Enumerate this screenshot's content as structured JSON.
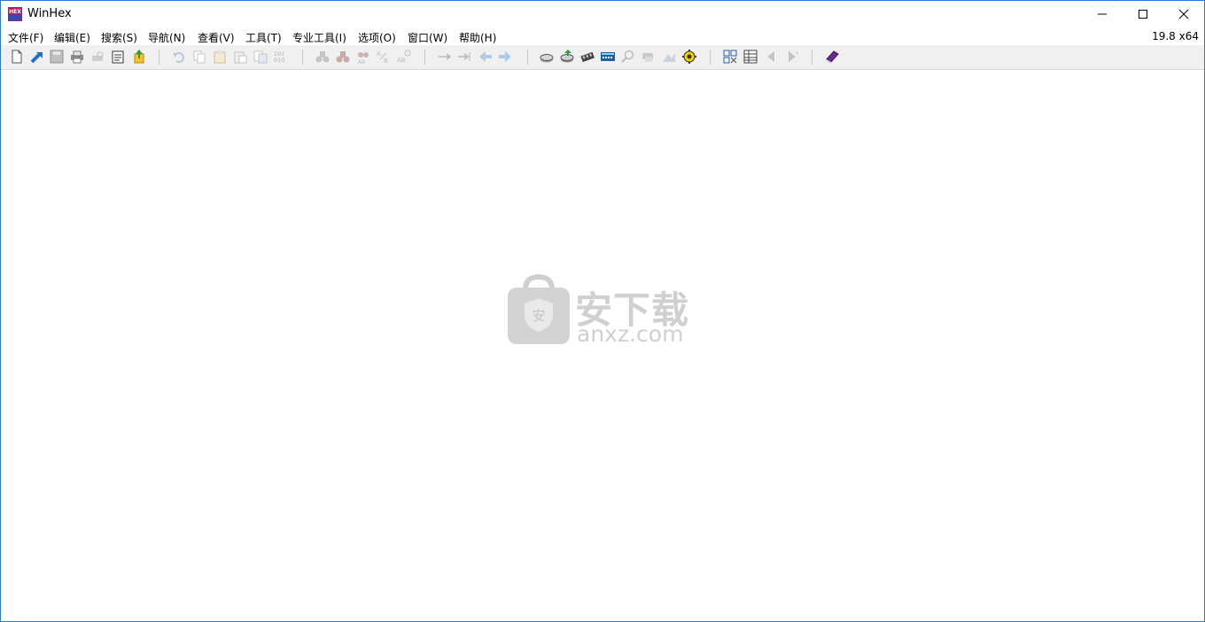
{
  "window": {
    "title": "WinHex",
    "version": "19.8 x64"
  },
  "menu": [
    "文件(F)",
    "编辑(E)",
    "搜索(S)",
    "导航(N)",
    "查看(V)",
    "工具(T)",
    "专业工具(I)",
    "选项(O)",
    "窗口(W)",
    "帮助(H)"
  ],
  "toolbar_icons": [
    "new-file-icon",
    "open-file-icon",
    "save-icon",
    "print-icon",
    "print-preview-icon",
    "properties-icon",
    "upload-icon",
    "undo-icon",
    "copy-icon",
    "cut-icon",
    "paste-icon",
    "paste-special-icon",
    "binary-icon",
    "find-icon",
    "find-hex-icon",
    "replace-icon",
    "replace-hex-icon",
    "find-text-icon",
    "go-to-offset-icon",
    "go-to-sector-icon",
    "back-icon",
    "forward-icon",
    "open-disk-icon",
    "open-disk-image-icon",
    "ram-editor-icon",
    "calculator-icon",
    "analyze-icon",
    "hash-icon",
    "wipe-icon",
    "tools-icon",
    "view-mode-icon",
    "data-interpreter-icon",
    "prev-window-icon",
    "next-window-icon",
    "help-book-icon"
  ],
  "watermark": {
    "text": "安下载",
    "domain": "anxz.com"
  }
}
